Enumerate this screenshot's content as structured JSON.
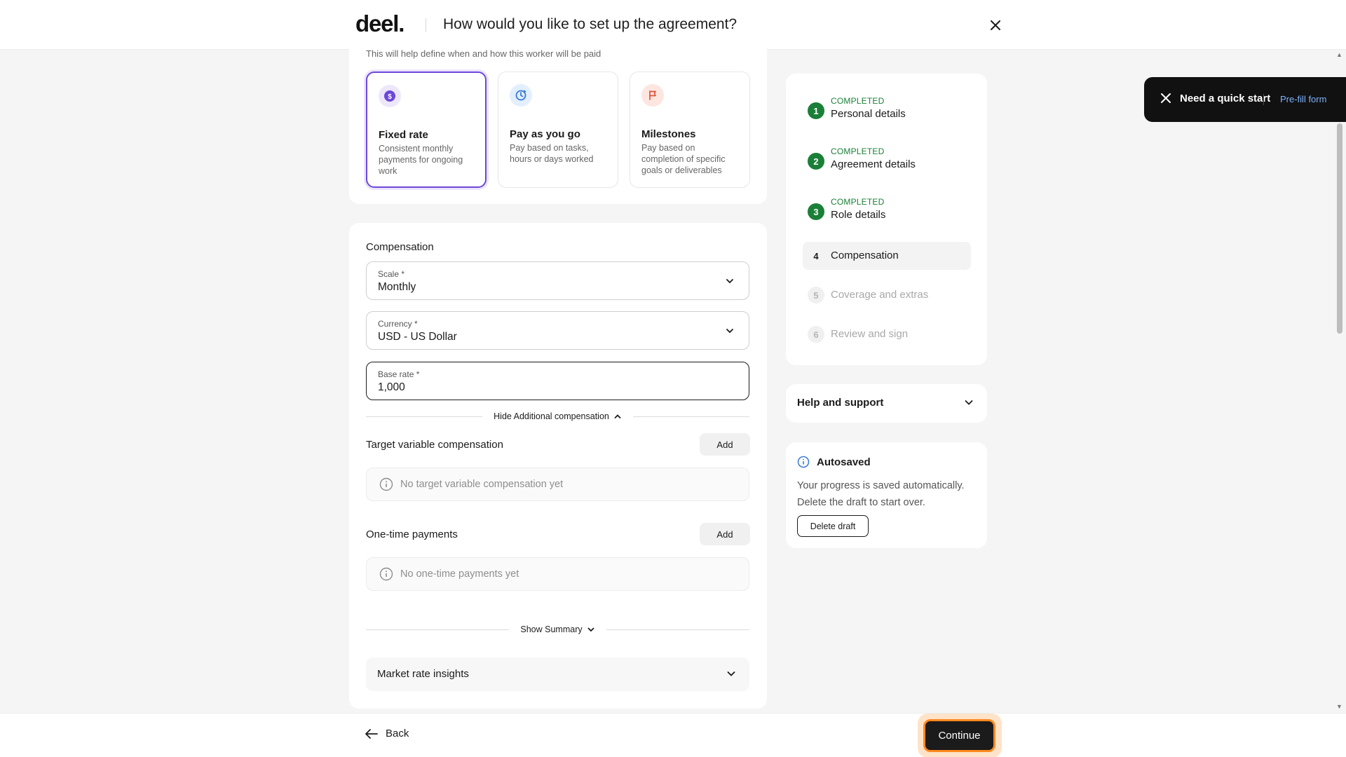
{
  "header": {
    "logo": "deel.",
    "title": "How would you like to set up the agreement?"
  },
  "contract_type": {
    "subtitle": "This will help define when and how this worker will be paid",
    "options": [
      {
        "title": "Fixed rate",
        "desc": "Consistent monthly payments for ongoing work",
        "icon": "dollar-coin-icon",
        "selected": true
      },
      {
        "title": "Pay as you go",
        "desc": "Pay based on tasks, hours or days worked",
        "icon": "clock-refresh-icon",
        "selected": false
      },
      {
        "title": "Milestones",
        "desc": "Pay based on completion of specific goals or deliverables",
        "icon": "flag-icon",
        "selected": false
      }
    ]
  },
  "compensation": {
    "title": "Compensation",
    "scale": {
      "label": "Scale *",
      "value": "Monthly"
    },
    "currency": {
      "label": "Currency *",
      "value": "USD - US Dollar"
    },
    "base_rate": {
      "label": "Base rate *",
      "value": "1,000"
    },
    "toggle_additional": "Hide Additional compensation",
    "target_variable": {
      "title": "Target variable compensation",
      "add": "Add",
      "empty": "No target variable compensation yet"
    },
    "one_time": {
      "title": "One-time payments",
      "add": "Add",
      "empty": "No one-time payments yet"
    },
    "show_summary": "Show Summary",
    "market_rate": "Market rate insights"
  },
  "steps": [
    {
      "num": "1",
      "state": "COMPLETED",
      "name": "Personal details"
    },
    {
      "num": "2",
      "state": "COMPLETED",
      "name": "Agreement details"
    },
    {
      "num": "3",
      "state": "COMPLETED",
      "name": "Role details"
    },
    {
      "num": "4",
      "state": "",
      "name": "Compensation"
    },
    {
      "num": "5",
      "state": "",
      "name": "Coverage and extras"
    },
    {
      "num": "6",
      "state": "",
      "name": "Review and sign"
    }
  ],
  "help": {
    "title": "Help and support"
  },
  "autosave": {
    "title": "Autosaved",
    "desc": "Your progress is saved automatically. Delete the draft to start over.",
    "delete": "Delete draft"
  },
  "toast": {
    "message": "Need a quick start",
    "link": "Pre-fill form"
  },
  "footer": {
    "back": "Back",
    "continue": "Continue"
  },
  "colors": {
    "accent": "#6c48d8",
    "success": "#1a7f37",
    "focus_ring": "#ff8a1f"
  }
}
